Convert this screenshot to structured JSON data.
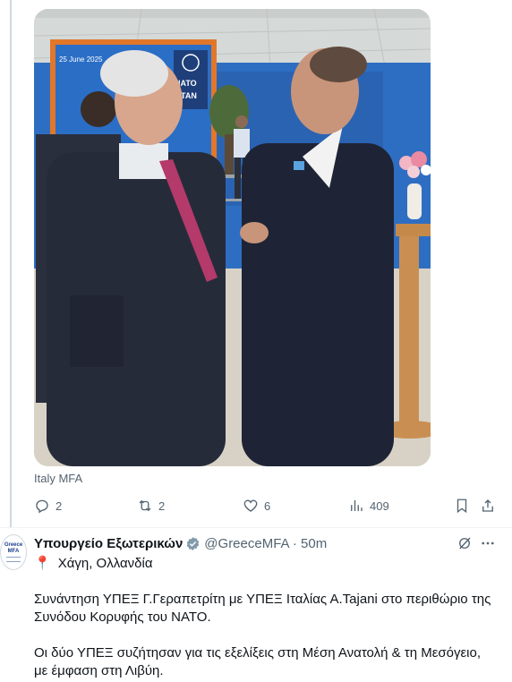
{
  "photo_credit": "Italy MFA",
  "photo_texts": {
    "date": "25 June 2025",
    "banner_top": "NATO",
    "banner_bottom": "OTAN"
  },
  "actions": {
    "replies": "2",
    "reposts": "2",
    "likes": "6",
    "views": "409"
  },
  "tweet": {
    "display_name": "Υπουργείο Εξωτερικών",
    "handle_time": "@GreeceMFA · 50m",
    "avatar_line1": "Greece",
    "avatar_line2": "MFA",
    "location": "Χάγη, Ολλανδία",
    "paragraph1_line1": "Συνάντηση ΥΠΕΞ Γ.Γεραπετρίτη με ΥΠΕΞ Ιταλίας Α.Tajani στο περιθώριο της",
    "paragraph1_line2": "Συνόδου Κορυφής του ΝΑΤΟ.",
    "paragraph2_line1": "Οι δύο ΥΠΕΞ συζήτησαν για τις εξελίξεις στη Μέση Ανατολή & τη Μεσόγειο,",
    "paragraph2_line2": "με έμφαση στη Λιβύη."
  },
  "colors": {
    "text": "#0f1419",
    "muted": "#536471",
    "verified_badge": "#829aab",
    "pin": "#e0245e"
  }
}
